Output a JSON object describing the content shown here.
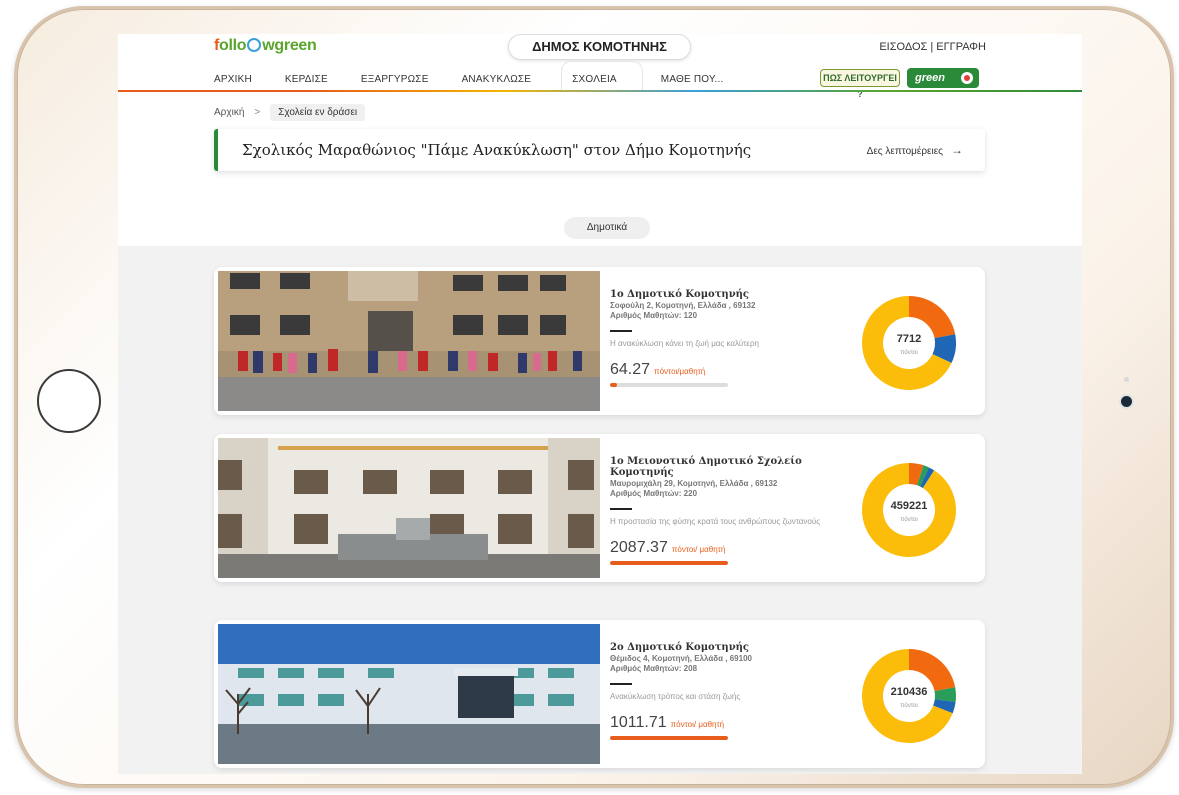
{
  "header": {
    "logo_parts": [
      "f",
      "ollo",
      "wgreen"
    ],
    "municipality": "ΔΗΜΟΣ ΚΟΜΟΤΗΝΗΣ",
    "auth": "ΕΙΣΟΔΟΣ | ΕΓΓΡΑΦΗ",
    "nav": [
      "ΑΡΧΙΚΗ",
      "ΚΕΡΔΙΣΕ",
      "ΕΞΑΡΓΥΡΩΣΕ",
      "ΑΝΑΚΥΚΛΩΣΕ",
      "ΣΧΟΛΕΙΑ",
      "ΜΑΘΕ ΠΟΥ..."
    ],
    "active_nav": "ΣΧΟΛΕΙΑ",
    "how_badge": "ΠΩΣ ΛΕΙΤΟΥΡΓΕΙ ?",
    "green_badge": "green"
  },
  "breadcrumb": {
    "home": "Αρχική",
    "separator": ">",
    "current": "Σχολεία εν δράσει"
  },
  "banner": {
    "title": "Σχολικός Μαραθώνιος \"Πάμε Ανακύκλωση\" στον Δήμο Κομοτηνής",
    "link": "Δες λεπτομέρειες",
    "arrow": "→"
  },
  "filter": {
    "label": "Δημοτικά"
  },
  "colors": {
    "orange": "#f26a10",
    "yellow": "#fbbd0a",
    "blue": "#1f67b5",
    "green": "#2a9d5a",
    "accent": "#e85d1b"
  },
  "schools": [
    {
      "name": "1ο Δημοτικό Κομοτηνής",
      "address": "Σοφούλη 2, Κομοτηνή, Ελλάδα , 69132",
      "students": "Αριθμός Μαθητών: 120",
      "motto": "Η ανακύκλωση κάνει τη ζωή μας καλύτερη",
      "score": "64.27",
      "score_unit": "πόντοι/μαθητή",
      "progress": 0.06,
      "points": "7712",
      "points_unit": "πόντοι",
      "slices": [
        {
          "value": 0.22,
          "color": "#f26a10"
        },
        {
          "value": 0.1,
          "color": "#1f67b5"
        },
        {
          "value": 0.68,
          "color": "#fbbd0a"
        }
      ]
    },
    {
      "name": "1ο Μειονοτικό Δημοτικό Σχολείο Κομοτηνής",
      "address": "Μαυρομιχάλη 29, Κομοτηνή, Ελλάδα , 69132",
      "students": "Αριθμός Μαθητών: 220",
      "motto": "Η προστασία της φύσης κρατά τους ανθρώπους ζωντανούς",
      "score": "2087.37",
      "score_unit": "πόντοι/ μαθητή",
      "progress": 1.0,
      "points": "459221",
      "points_unit": "πόντοι",
      "slices": [
        {
          "value": 0.05,
          "color": "#f26a10"
        },
        {
          "value": 0.02,
          "color": "#2a9d5a"
        },
        {
          "value": 0.02,
          "color": "#1f67b5"
        },
        {
          "value": 0.91,
          "color": "#fbbd0a"
        }
      ]
    },
    {
      "name": "2ο Δημοτικό Κομοτηνής",
      "address": "Θέμιδος 4, Κομοτηνή, Ελλάδα , 69100",
      "students": "Αριθμός Μαθητών: 208",
      "motto": "Ανακύκλωση τρόπος και στάση ζωής",
      "score": "1011.71",
      "score_unit": "πόντοι/ μαθητή",
      "progress": 1.0,
      "points": "210436",
      "points_unit": "πόντοι",
      "slices": [
        {
          "value": 0.22,
          "color": "#f26a10"
        },
        {
          "value": 0.05,
          "color": "#2a9d5a"
        },
        {
          "value": 0.04,
          "color": "#1f67b5"
        },
        {
          "value": 0.69,
          "color": "#fbbd0a"
        }
      ]
    }
  ]
}
